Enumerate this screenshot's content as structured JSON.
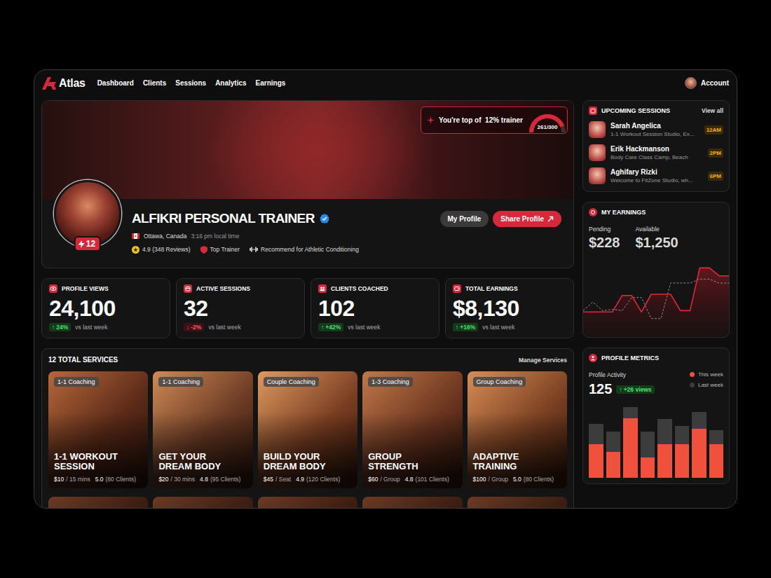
{
  "nav": {
    "brand": "Atlas",
    "items": [
      "Dashboard",
      "Clients",
      "Sessions",
      "Analytics",
      "Earnings"
    ],
    "account": "Account"
  },
  "hero": {
    "rank_text": "You're top of  12% trainer",
    "score": "261/300",
    "score_level": 0.87
  },
  "profile": {
    "name": "ALFIKRI PERSONAL TRAINER",
    "verified": true,
    "level": "12",
    "location": "Ottawa, Canada",
    "local_time": "3:16 pm local time",
    "rating": "4.9 (348 Reviews)",
    "badge": "Top Trainer",
    "specialty": "Recommend for Athletic Conditioning",
    "buttons": [
      "My Profile",
      "Share Profile"
    ]
  },
  "stats": [
    {
      "title": "PROFILE VIEWS",
      "value": "24,100",
      "arrow": "↑",
      "delta": "24%",
      "note": "vs last week",
      "trend": "up"
    },
    {
      "title": "ACTIVE SESSIONS",
      "value": "32",
      "arrow": "↓",
      "delta": "-2%",
      "note": "vs last week",
      "trend": "down"
    },
    {
      "title": "CLIENTS COACHED",
      "value": "102",
      "arrow": "↑",
      "delta": "+42%",
      "note": "vs last week",
      "trend": "up"
    },
    {
      "title": "TOTAL EARNINGS",
      "value": "$8,130",
      "arrow": "↑",
      "delta": "+16%",
      "note": "vs last week",
      "trend": "up"
    }
  ],
  "services": {
    "title": "12 TOTAL SERVICES",
    "manage": "Manage Services",
    "cards": [
      {
        "tag": "1-1 Coaching",
        "title": "1-1 WORKOUT SESSION",
        "price": "$10",
        "unit": "/ 15 mins",
        "rating": "5.0",
        "clients": "(80 Clients)"
      },
      {
        "tag": "1-1 Coaching",
        "title": "GET YOUR DREAM BODY",
        "price": "$20",
        "unit": "/ 30 mins",
        "rating": "4.8",
        "clients": "(95 Clients)"
      },
      {
        "tag": "Couple Coaching",
        "title": "BUILD YOUR DREAM BODY",
        "price": "$45",
        "unit": "/ Seat",
        "rating": "4.9",
        "clients": "(120 Clients)"
      },
      {
        "tag": "1-3 Coaching",
        "title": "GROUP STRENGTH",
        "price": "$60",
        "unit": "/ Group",
        "rating": "4.8",
        "clients": "(101 Clients)"
      },
      {
        "tag": "Group Coaching",
        "title": "ADAPTIVE TRAINING",
        "price": "$100",
        "unit": "/ Group",
        "rating": "5.0",
        "clients": "(80 Clients)"
      }
    ]
  },
  "upcoming": {
    "title": "UPCOMING SESSIONS",
    "view_all": "View all",
    "items": [
      {
        "name": "Sarah Angelica",
        "desc": "1-1 Workout Session Studio, Ex...",
        "time": "12AM"
      },
      {
        "name": "Erik Hackmanson",
        "desc": "Body Care Class Camp, Beach",
        "time": "2PM"
      },
      {
        "name": "Aghifary Rizki",
        "desc": "Welcome to FitZone Studio, wh...",
        "time": "6PM"
      }
    ]
  },
  "earnings": {
    "title": "MY EARNINGS",
    "pending_label": "Pending",
    "pending": "$228",
    "available_label": "Available",
    "available": "$1,250",
    "series": [
      {
        "name": "current",
        "color": "#e0283a",
        "values": [
          38,
          38,
          38,
          38,
          63,
          63,
          38,
          65,
          65,
          65,
          40,
          40,
          105,
          105,
          93,
          93
        ]
      },
      {
        "name": "previous",
        "color": "#8a8a8a",
        "values": [
          40,
          53,
          40,
          42,
          40,
          60,
          60,
          28,
          28,
          82,
          82,
          82,
          88,
          88,
          82,
          82
        ]
      }
    ]
  },
  "metrics": {
    "title": "PROFILE METRICS",
    "label": "Profile Activity",
    "value": "125",
    "arrow": "↑",
    "delta": "+26 views",
    "series": [
      {
        "label": "This week",
        "color": "#f0513c",
        "values": [
          48,
          37,
          85,
          29,
          48,
          48,
          70,
          48
        ]
      },
      {
        "label": "Last week",
        "color": "#3c3c3c",
        "values": [
          77,
          66,
          101,
          66,
          84,
          74,
          94,
          68
        ]
      }
    ]
  }
}
